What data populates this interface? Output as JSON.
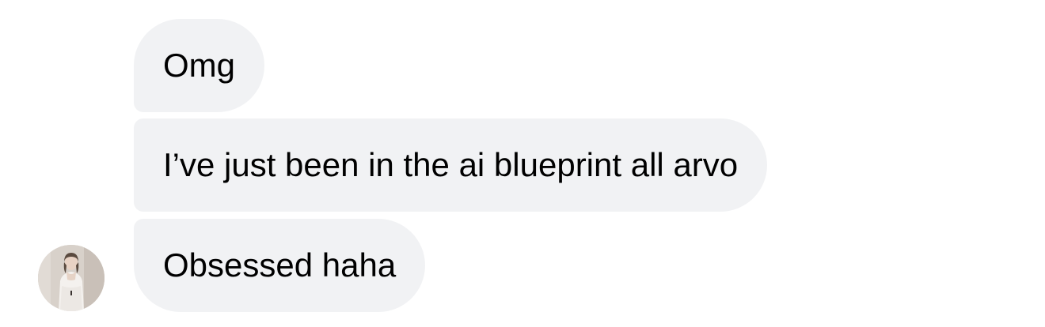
{
  "colors": {
    "bubble_background": "#f1f2f4",
    "text": "#000000",
    "page_background": "#ffffff"
  },
  "messages": [
    {
      "text": "Omg"
    },
    {
      "text": "I’ve just been in the ai blueprint all arvo"
    },
    {
      "text": "Obsessed haha"
    }
  ],
  "sender": {
    "avatar_icon": "profile-photo-icon"
  }
}
